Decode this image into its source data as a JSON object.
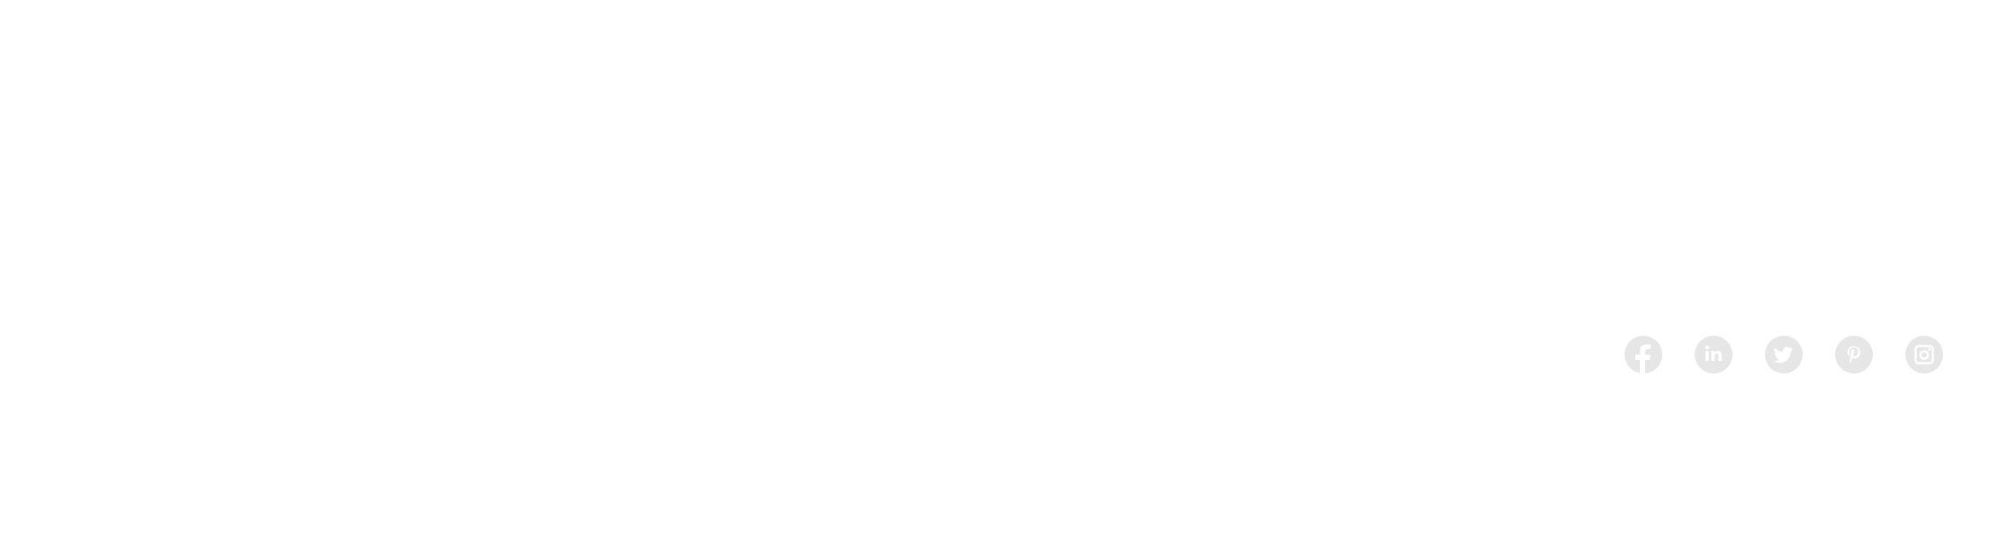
{
  "social": {
    "icon_color": "#e6e6e6",
    "glyph_color": "#ffffff",
    "items": [
      {
        "icon": "facebook-icon"
      },
      {
        "icon": "linkedin-icon"
      },
      {
        "icon": "twitter-icon"
      },
      {
        "icon": "pinterest-icon"
      },
      {
        "icon": "instagram-icon"
      }
    ]
  }
}
